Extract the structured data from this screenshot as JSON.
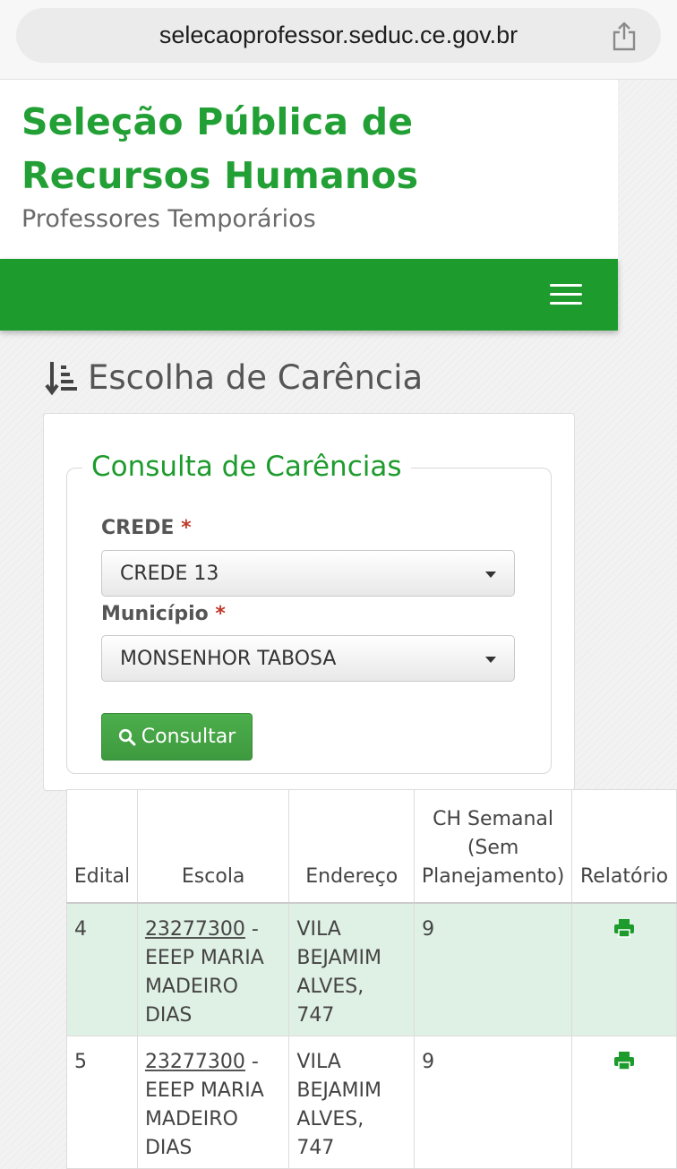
{
  "browser": {
    "url": "selecaoprofessor.seduc.ce.gov.br"
  },
  "header": {
    "title": "Seleção Pública de Recursos Humanos",
    "subtitle": "Professores Temporários"
  },
  "page": {
    "heading": "Escolha de Carência"
  },
  "form": {
    "legend": "Consulta de Carências",
    "crede_label": "CREDE",
    "crede_value": "CREDE 13",
    "municipio_label": "Município",
    "municipio_value": "MONSENHOR TABOSA",
    "required_mark": "*",
    "submit_label": "Consultar"
  },
  "table": {
    "headers": [
      "Edital",
      "Escola",
      "Endereço",
      "CH Semanal (Sem Planejamento)",
      "Relatório"
    ],
    "rows": [
      {
        "edital": "4",
        "escola_code": "23277300",
        "escola_name": " - EEEP MARIA MADEIRO DIAS",
        "endereco": "VILA BEJAMIM ALVES, 747",
        "ch": "9"
      },
      {
        "edital": "5",
        "escola_code": "23277300",
        "escola_name": " - EEEP MARIA MADEIRO DIAS",
        "endereco": "VILA BEJAMIM ALVES, 747",
        "ch": "9"
      }
    ]
  },
  "colors": {
    "brand_green": "#1d9b2d",
    "title_green": "#23a035",
    "row_highlight": "#dff0e4"
  },
  "icons": {
    "share": "share-icon",
    "menu": "hamburger-icon",
    "heading": "sort-list-icon",
    "search": "search-icon",
    "print": "print-icon"
  }
}
